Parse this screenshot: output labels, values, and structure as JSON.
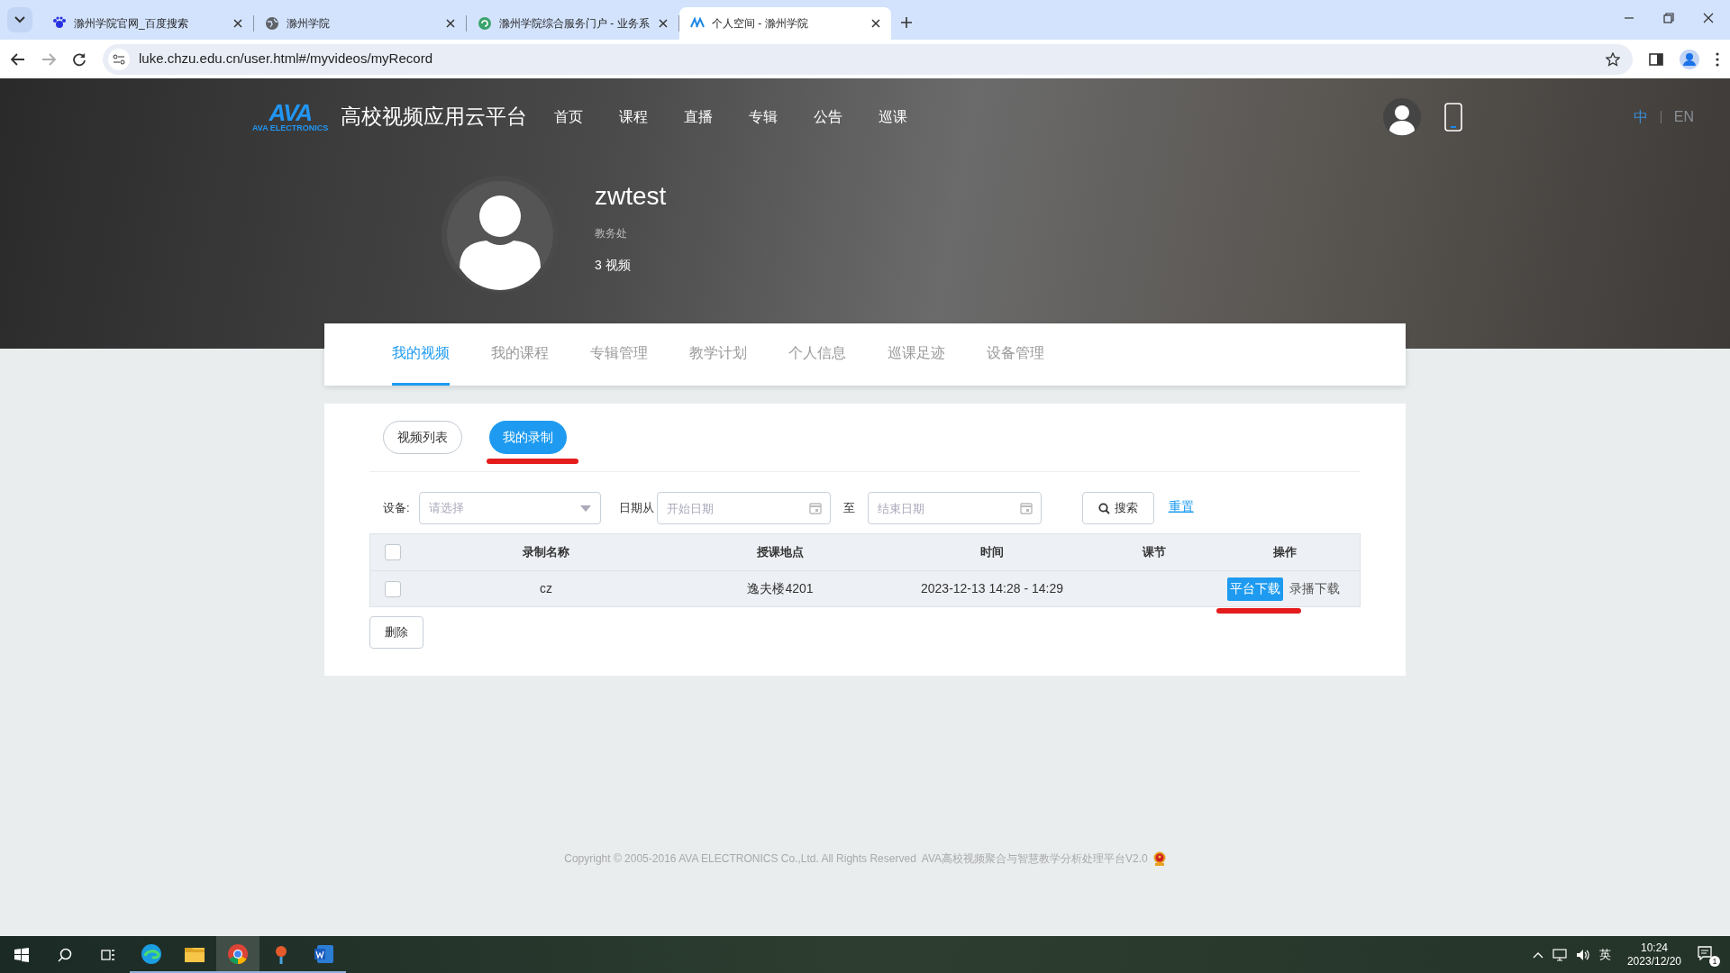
{
  "browser": {
    "tabs": [
      {
        "title": "滁州学院官网_百度搜索",
        "selected": false
      },
      {
        "title": "滁州学院",
        "selected": false
      },
      {
        "title": "滁州学院综合服务门户 - 业务系",
        "selected": false
      },
      {
        "title": "个人空间 - 滁州学院",
        "selected": true
      }
    ],
    "url": "luke.chzu.edu.cn/user.html#/myvideos/myRecord"
  },
  "header": {
    "logo": {
      "mark": "AVA",
      "caption": "AVA ELECTRONICS"
    },
    "site_title": "高校视频应用云平台",
    "nav": [
      "首页",
      "课程",
      "直播",
      "专辑",
      "公告",
      "巡课"
    ],
    "languages": [
      {
        "label": "中",
        "selected": true
      },
      {
        "label": "EN",
        "selected": false
      }
    ]
  },
  "profile": {
    "name": "zwtest",
    "department": "教务处",
    "videos": "3 视频"
  },
  "page_tabs": [
    {
      "label": "我的视频",
      "selected": true
    },
    {
      "label": "我的课程",
      "selected": false
    },
    {
      "label": "专辑管理",
      "selected": false
    },
    {
      "label": "教学计划",
      "selected": false
    },
    {
      "label": "个人信息",
      "selected": false
    },
    {
      "label": "巡课足迹",
      "selected": false
    },
    {
      "label": "设备管理",
      "selected": false
    }
  ],
  "sub_tabs": [
    {
      "label": "视频列表",
      "selected": false,
      "annotated": false
    },
    {
      "label": "我的录制",
      "selected": true,
      "annotated": true
    }
  ],
  "filters": {
    "device_label": "设备:",
    "device_placeholder": "请选择",
    "date_from_label": "日期从",
    "start_placeholder": "开始日期",
    "to_label": "至",
    "end_placeholder": "结束日期",
    "search_button": "搜索",
    "reset_link": "重置"
  },
  "table": {
    "all_checked": false,
    "columns": [
      "录制名称",
      "授课地点",
      "时间",
      "课节",
      "操作"
    ],
    "rows": [
      {
        "checked": false,
        "cells": [
          "cz",
          "逸夫楼4201",
          "2023-12-13 14:28 - 14:29",
          ""
        ],
        "actions": [
          {
            "label": "平台下载",
            "kind": "primary",
            "annotated": true
          },
          {
            "label": "录播下载",
            "kind": "plain",
            "annotated": false
          }
        ]
      }
    ]
  },
  "delete_button": "删除",
  "footer": "Copyright © 2005-2016 AVA ELECTRONICS Co.,Ltd. All Rights Reserved  AVA高校视频聚合与智慧教学分析处理平台V2.0",
  "taskbar": {
    "input_method": "英",
    "time": "10:24",
    "date": "2023/12/20",
    "notifications": "1"
  }
}
